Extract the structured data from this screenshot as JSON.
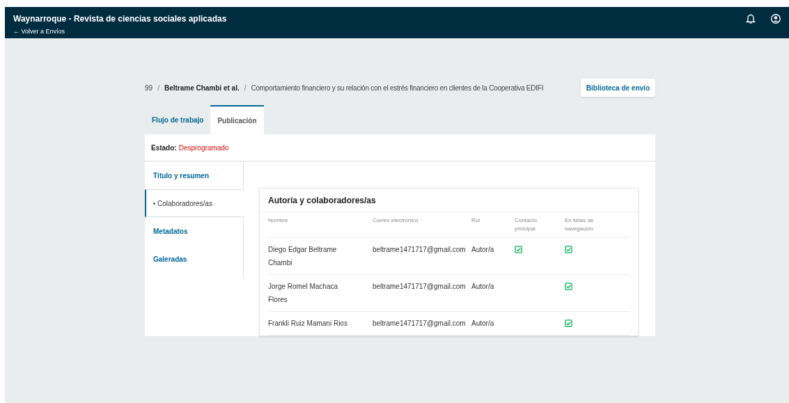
{
  "header": {
    "title": "Waynarroque - Revista de ciencias sociales aplicadas",
    "back_link": "← Volver a Envíos"
  },
  "breadcrumb": {
    "id": "99",
    "separator_1": "/",
    "separator_2": "/",
    "authors": "Beltrame Chambi et al.",
    "title": "Comportamiento financiero y su relación con el estrés financiero en clientes de la Cooperativa EDIFI",
    "library_button": "Biblioteca de envío"
  },
  "tabs": [
    {
      "label": "Flujo de trabajo",
      "selected": false
    },
    {
      "label": "Publicación",
      "selected": true
    }
  ],
  "status": {
    "label": "Estado:",
    "value": "Desprogramado"
  },
  "side_nav": [
    {
      "label": "Título y resumen",
      "selected": false
    },
    {
      "label": "Colaboradores/as",
      "selected": true
    },
    {
      "label": "Metadatos",
      "selected": false
    },
    {
      "label": "Galeradas",
      "selected": false
    }
  ],
  "contributors": {
    "title": "Autoría y colaboradores/as",
    "columns": [
      "Nombre",
      "Correo electrónico",
      "Rol",
      "Contacto principal",
      "En listas de navegación"
    ],
    "rows": [
      {
        "name": "Diego Edgar Beltrame Chambi",
        "email": "beltrame1471717@gmail.com",
        "role": "Autor/a",
        "primary_contact": true,
        "in_browse": true
      },
      {
        "name": "Jorge Romel Machaca Flores",
        "email": "beltrame1471717@gmail.com",
        "role": "Autor/a",
        "primary_contact": false,
        "in_browse": true
      },
      {
        "name": "Frankli Ruiz Mamani Rios",
        "email": "beltrame1471717@gmail.com",
        "role": "Autor/a",
        "primary_contact": false,
        "in_browse": true
      }
    ]
  }
}
